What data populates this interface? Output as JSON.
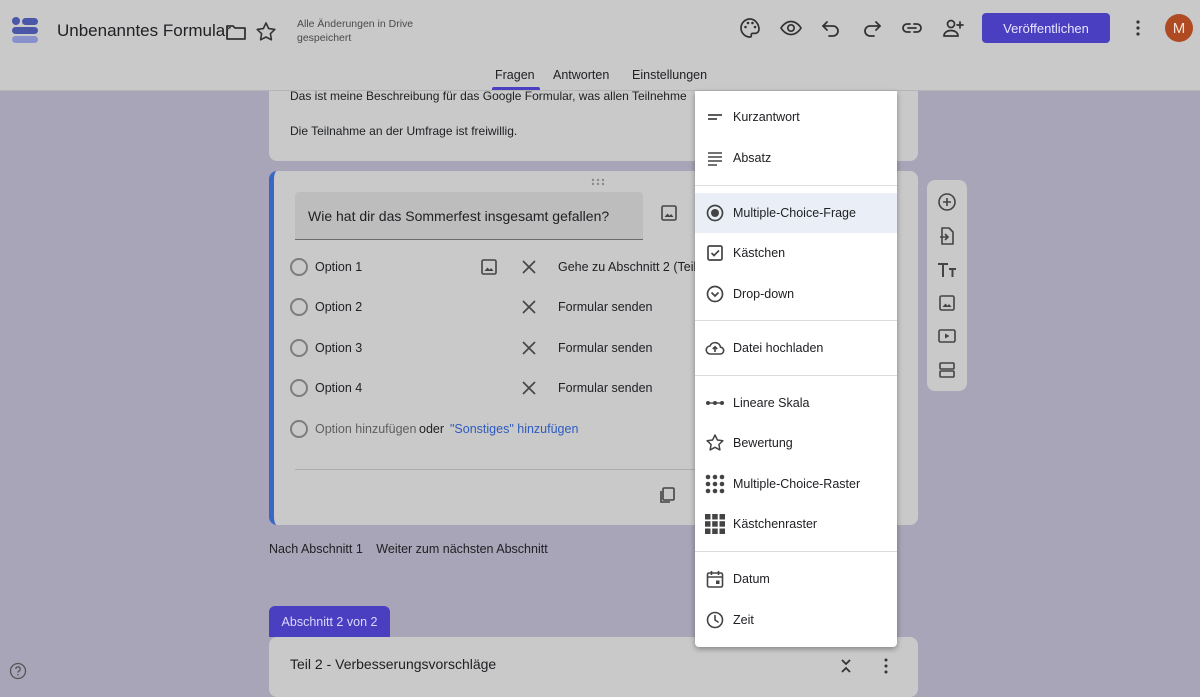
{
  "header": {
    "title": "Unbenanntes Formular",
    "save_status": "Alle Änderungen in Drive gespeichert",
    "publish_label": "Veröffentlichen",
    "avatar_initial": "M",
    "icons": [
      "folder-icon",
      "star-icon",
      "palette-icon",
      "eye-icon",
      "undo-icon",
      "redo-icon",
      "link-icon",
      "add-person-icon",
      "more-vert-icon"
    ],
    "tabs": [
      {
        "label": "Fragen",
        "active": true
      },
      {
        "label": "Antworten",
        "active": false
      },
      {
        "label": "Einstellungen",
        "active": false
      }
    ]
  },
  "colors": {
    "accent": "#4a3fc0",
    "question_border": "#3a67c4",
    "link": "#2d5bbf",
    "avatar": "#b04a22"
  },
  "description": {
    "line1": "Das ist meine Beschreibung für das Google Formular, was allen Teilnehme",
    "line2": "Die Teilnahme an der Umfrage ist freiwillig."
  },
  "question": {
    "title": "Wie hat dir das Sommerfest insgesamt gefallen?",
    "options": [
      {
        "label": "Option 1",
        "goto": "Gehe zu Abschnitt 2 (Teil"
      },
      {
        "label": "Option 2",
        "goto": "Formular senden"
      },
      {
        "label": "Option 3",
        "goto": "Formular senden"
      },
      {
        "label": "Option 4",
        "goto": "Formular senden"
      }
    ],
    "add_option": "Option hinzufügen",
    "or": "oder",
    "add_other": "\"Sonstiges\" hinzufügen"
  },
  "after_section": {
    "label": "Nach Abschnitt 1",
    "value": "Weiter zum nächsten Abschnitt"
  },
  "section2": {
    "tab": "Abschnitt 2 von 2",
    "title": "Teil 2 - Verbesserungsvorschläge"
  },
  "side_toolbar": {
    "icons": [
      "add-circle-icon",
      "import-question-icon",
      "title-text-icon",
      "image-icon",
      "video-icon",
      "section-icon"
    ]
  },
  "menu": {
    "items": [
      {
        "label": "Kurzantwort",
        "icon": "short-text-icon",
        "selected": false
      },
      {
        "label": "Absatz",
        "icon": "paragraph-icon",
        "selected": false
      },
      {
        "label": "Multiple-Choice-Frage",
        "icon": "radio-button-icon",
        "selected": true
      },
      {
        "label": "Kästchen",
        "icon": "checkbox-icon",
        "selected": false
      },
      {
        "label": "Drop-down",
        "icon": "dropdown-icon",
        "selected": false
      },
      {
        "label": "Datei hochladen",
        "icon": "cloud-upload-icon",
        "selected": false
      },
      {
        "label": "Lineare Skala",
        "icon": "linear-scale-icon",
        "selected": false
      },
      {
        "label": "Bewertung",
        "icon": "star-outline-icon",
        "selected": false
      },
      {
        "label": "Multiple-Choice-Raster",
        "icon": "dot-grid-icon",
        "selected": false
      },
      {
        "label": "Kästchenraster",
        "icon": "checkbox-grid-icon",
        "selected": false
      },
      {
        "label": "Datum",
        "icon": "calendar-icon",
        "selected": false
      },
      {
        "label": "Zeit",
        "icon": "clock-icon",
        "selected": false
      }
    ]
  }
}
